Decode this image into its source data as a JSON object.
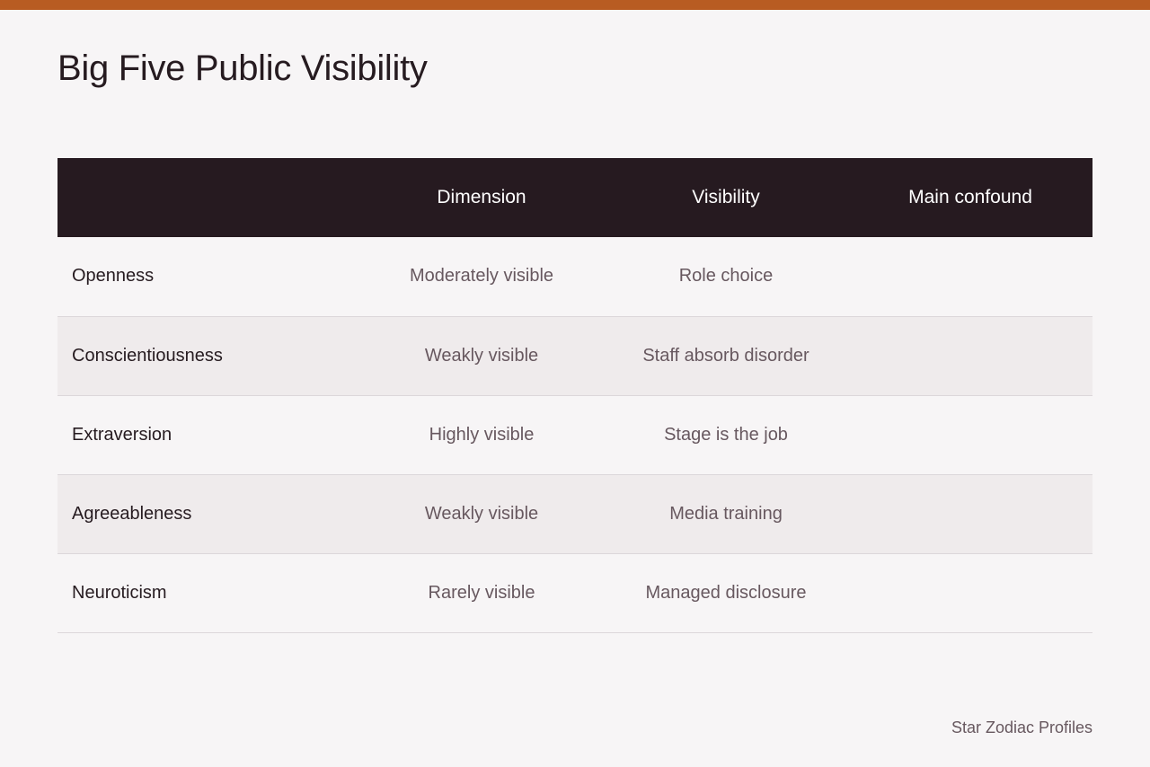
{
  "colors": {
    "accent_bar": "#b85c22",
    "header_bg": "#261a20",
    "page_bg": "#f7f5f6",
    "stripe_bg": "#efebec"
  },
  "page": {
    "title": "Big Five Public Visibility"
  },
  "table": {
    "headers": [
      "",
      "Dimension",
      "Visibility",
      "Main confound"
    ],
    "rows": [
      {
        "trait": "Openness",
        "dimension": "Moderately visible",
        "visibility": "Role choice",
        "confound": ""
      },
      {
        "trait": "Conscientiousness",
        "dimension": "Weakly visible",
        "visibility": "Staff absorb disorder",
        "confound": ""
      },
      {
        "trait": "Extraversion",
        "dimension": "Highly visible",
        "visibility": "Stage is the job",
        "confound": ""
      },
      {
        "trait": "Agreeableness",
        "dimension": "Weakly visible",
        "visibility": "Media training",
        "confound": ""
      },
      {
        "trait": "Neuroticism",
        "dimension": "Rarely visible",
        "visibility": "Managed disclosure",
        "confound": ""
      }
    ]
  },
  "footer": {
    "credit": "Star Zodiac Profiles"
  }
}
